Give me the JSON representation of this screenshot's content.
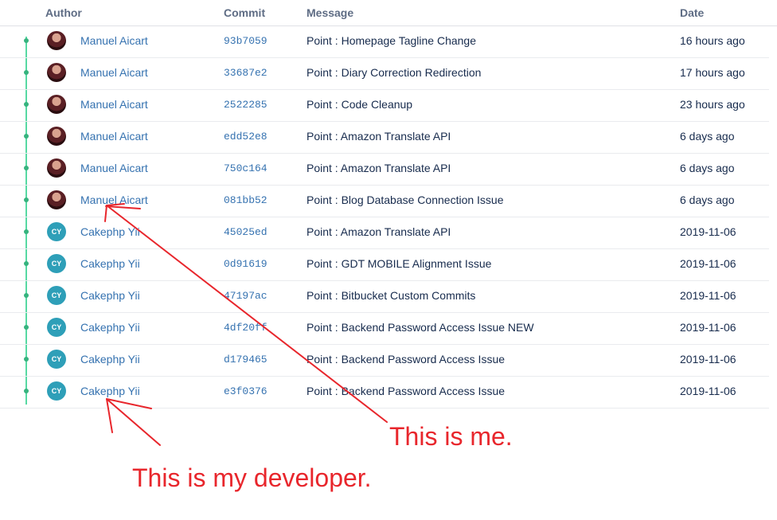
{
  "columns": {
    "author": "Author",
    "commit": "Commit",
    "message": "Message",
    "date": "Date"
  },
  "rows": [
    {
      "author": "Manuel Aicart",
      "avatar": "photo",
      "initials": "",
      "commit": "93b7059",
      "message": "Point : Homepage Tagline Change",
      "date": "16 hours ago"
    },
    {
      "author": "Manuel Aicart",
      "avatar": "photo",
      "initials": "",
      "commit": "33687e2",
      "message": "Point : Diary Correction Redirection",
      "date": "17 hours ago"
    },
    {
      "author": "Manuel Aicart",
      "avatar": "photo",
      "initials": "",
      "commit": "2522285",
      "message": "Point : Code Cleanup",
      "date": "23 hours ago"
    },
    {
      "author": "Manuel Aicart",
      "avatar": "photo",
      "initials": "",
      "commit": "edd52e8",
      "message": "Point : Amazon Translate API",
      "date": "6 days ago"
    },
    {
      "author": "Manuel Aicart",
      "avatar": "photo",
      "initials": "",
      "commit": "750c164",
      "message": "Point : Amazon Translate API",
      "date": "6 days ago"
    },
    {
      "author": "Manuel Aicart",
      "avatar": "photo",
      "initials": "",
      "commit": "081bb52",
      "message": "Point : Blog Database Connection Issue",
      "date": "6 days ago"
    },
    {
      "author": "Cakephp Yii",
      "avatar": "initials",
      "initials": "CY",
      "commit": "45025ed",
      "message": "Point : Amazon Translate API",
      "date": "2019-11-06"
    },
    {
      "author": "Cakephp Yii",
      "avatar": "initials",
      "initials": "CY",
      "commit": "0d91619",
      "message": "Point : GDT MOBILE Alignment Issue",
      "date": "2019-11-06"
    },
    {
      "author": "Cakephp Yii",
      "avatar": "initials",
      "initials": "CY",
      "commit": "47197ac",
      "message": "Point : Bitbucket Custom Commits",
      "date": "2019-11-06"
    },
    {
      "author": "Cakephp Yii",
      "avatar": "initials",
      "initials": "CY",
      "commit": "4df20ff",
      "message": "Point : Backend Password Access Issue NEW",
      "date": "2019-11-06"
    },
    {
      "author": "Cakephp Yii",
      "avatar": "initials",
      "initials": "CY",
      "commit": "d179465",
      "message": "Point : Backend Password Access Issue",
      "date": "2019-11-06"
    },
    {
      "author": "Cakephp Yii",
      "avatar": "initials",
      "initials": "CY",
      "commit": "e3f0376",
      "message": "Point : Backend Password Access Issue",
      "date": "2019-11-06"
    }
  ],
  "annotations": {
    "me": "This is me.",
    "developer": "This is my developer."
  },
  "colors": {
    "link": "#3572b0",
    "text": "#172b4d",
    "graph": "#36b37e",
    "annotation": "#e8262c",
    "avatar_initials_bg": "#2e9fb8"
  }
}
